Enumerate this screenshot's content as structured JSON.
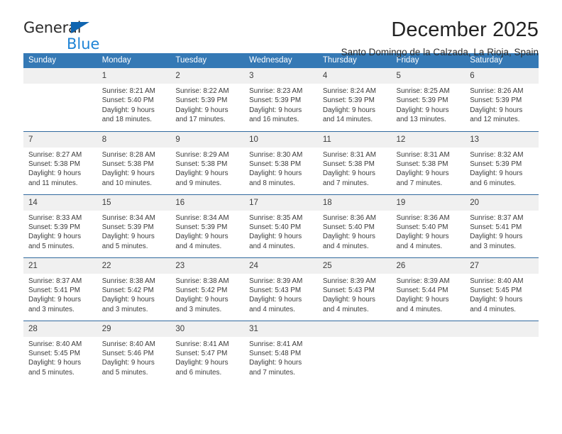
{
  "logo": {
    "line1": "General",
    "line2": "Blue",
    "triangle_icon": "triangle-icon",
    "color_dark": "#2b2b2b",
    "color_blue": "#1f84d6",
    "triangle_color": "#1065b0"
  },
  "header": {
    "title": "December 2025",
    "subtitle": "Santo Domingo de la Calzada, La Rioja, Spain"
  },
  "theme": {
    "header_blue": "#3579b5",
    "row_rule": "#31699e",
    "daynum_band": "#f0f0f0",
    "text": "#3b3b3b"
  },
  "weekday_headers": [
    "Sunday",
    "Monday",
    "Tuesday",
    "Wednesday",
    "Thursday",
    "Friday",
    "Saturday"
  ],
  "weeks": [
    [
      {
        "day": "",
        "empty": true,
        "sunrise": "",
        "sunset": "",
        "daylight_line1": "",
        "daylight_line2": ""
      },
      {
        "day": "1",
        "empty": false,
        "sunrise": "Sunrise: 8:21 AM",
        "sunset": "Sunset: 5:40 PM",
        "daylight_line1": "Daylight: 9 hours",
        "daylight_line2": "and 18 minutes."
      },
      {
        "day": "2",
        "empty": false,
        "sunrise": "Sunrise: 8:22 AM",
        "sunset": "Sunset: 5:39 PM",
        "daylight_line1": "Daylight: 9 hours",
        "daylight_line2": "and 17 minutes."
      },
      {
        "day": "3",
        "empty": false,
        "sunrise": "Sunrise: 8:23 AM",
        "sunset": "Sunset: 5:39 PM",
        "daylight_line1": "Daylight: 9 hours",
        "daylight_line2": "and 16 minutes."
      },
      {
        "day": "4",
        "empty": false,
        "sunrise": "Sunrise: 8:24 AM",
        "sunset": "Sunset: 5:39 PM",
        "daylight_line1": "Daylight: 9 hours",
        "daylight_line2": "and 14 minutes."
      },
      {
        "day": "5",
        "empty": false,
        "sunrise": "Sunrise: 8:25 AM",
        "sunset": "Sunset: 5:39 PM",
        "daylight_line1": "Daylight: 9 hours",
        "daylight_line2": "and 13 minutes."
      },
      {
        "day": "6",
        "empty": false,
        "sunrise": "Sunrise: 8:26 AM",
        "sunset": "Sunset: 5:39 PM",
        "daylight_line1": "Daylight: 9 hours",
        "daylight_line2": "and 12 minutes."
      }
    ],
    [
      {
        "day": "7",
        "empty": false,
        "sunrise": "Sunrise: 8:27 AM",
        "sunset": "Sunset: 5:38 PM",
        "daylight_line1": "Daylight: 9 hours",
        "daylight_line2": "and 11 minutes."
      },
      {
        "day": "8",
        "empty": false,
        "sunrise": "Sunrise: 8:28 AM",
        "sunset": "Sunset: 5:38 PM",
        "daylight_line1": "Daylight: 9 hours",
        "daylight_line2": "and 10 minutes."
      },
      {
        "day": "9",
        "empty": false,
        "sunrise": "Sunrise: 8:29 AM",
        "sunset": "Sunset: 5:38 PM",
        "daylight_line1": "Daylight: 9 hours",
        "daylight_line2": "and 9 minutes."
      },
      {
        "day": "10",
        "empty": false,
        "sunrise": "Sunrise: 8:30 AM",
        "sunset": "Sunset: 5:38 PM",
        "daylight_line1": "Daylight: 9 hours",
        "daylight_line2": "and 8 minutes."
      },
      {
        "day": "11",
        "empty": false,
        "sunrise": "Sunrise: 8:31 AM",
        "sunset": "Sunset: 5:38 PM",
        "daylight_line1": "Daylight: 9 hours",
        "daylight_line2": "and 7 minutes."
      },
      {
        "day": "12",
        "empty": false,
        "sunrise": "Sunrise: 8:31 AM",
        "sunset": "Sunset: 5:38 PM",
        "daylight_line1": "Daylight: 9 hours",
        "daylight_line2": "and 7 minutes."
      },
      {
        "day": "13",
        "empty": false,
        "sunrise": "Sunrise: 8:32 AM",
        "sunset": "Sunset: 5:39 PM",
        "daylight_line1": "Daylight: 9 hours",
        "daylight_line2": "and 6 minutes."
      }
    ],
    [
      {
        "day": "14",
        "empty": false,
        "sunrise": "Sunrise: 8:33 AM",
        "sunset": "Sunset: 5:39 PM",
        "daylight_line1": "Daylight: 9 hours",
        "daylight_line2": "and 5 minutes."
      },
      {
        "day": "15",
        "empty": false,
        "sunrise": "Sunrise: 8:34 AM",
        "sunset": "Sunset: 5:39 PM",
        "daylight_line1": "Daylight: 9 hours",
        "daylight_line2": "and 5 minutes."
      },
      {
        "day": "16",
        "empty": false,
        "sunrise": "Sunrise: 8:34 AM",
        "sunset": "Sunset: 5:39 PM",
        "daylight_line1": "Daylight: 9 hours",
        "daylight_line2": "and 4 minutes."
      },
      {
        "day": "17",
        "empty": false,
        "sunrise": "Sunrise: 8:35 AM",
        "sunset": "Sunset: 5:40 PM",
        "daylight_line1": "Daylight: 9 hours",
        "daylight_line2": "and 4 minutes."
      },
      {
        "day": "18",
        "empty": false,
        "sunrise": "Sunrise: 8:36 AM",
        "sunset": "Sunset: 5:40 PM",
        "daylight_line1": "Daylight: 9 hours",
        "daylight_line2": "and 4 minutes."
      },
      {
        "day": "19",
        "empty": false,
        "sunrise": "Sunrise: 8:36 AM",
        "sunset": "Sunset: 5:40 PM",
        "daylight_line1": "Daylight: 9 hours",
        "daylight_line2": "and 4 minutes."
      },
      {
        "day": "20",
        "empty": false,
        "sunrise": "Sunrise: 8:37 AM",
        "sunset": "Sunset: 5:41 PM",
        "daylight_line1": "Daylight: 9 hours",
        "daylight_line2": "and 3 minutes."
      }
    ],
    [
      {
        "day": "21",
        "empty": false,
        "sunrise": "Sunrise: 8:37 AM",
        "sunset": "Sunset: 5:41 PM",
        "daylight_line1": "Daylight: 9 hours",
        "daylight_line2": "and 3 minutes."
      },
      {
        "day": "22",
        "empty": false,
        "sunrise": "Sunrise: 8:38 AM",
        "sunset": "Sunset: 5:42 PM",
        "daylight_line1": "Daylight: 9 hours",
        "daylight_line2": "and 3 minutes."
      },
      {
        "day": "23",
        "empty": false,
        "sunrise": "Sunrise: 8:38 AM",
        "sunset": "Sunset: 5:42 PM",
        "daylight_line1": "Daylight: 9 hours",
        "daylight_line2": "and 3 minutes."
      },
      {
        "day": "24",
        "empty": false,
        "sunrise": "Sunrise: 8:39 AM",
        "sunset": "Sunset: 5:43 PM",
        "daylight_line1": "Daylight: 9 hours",
        "daylight_line2": "and 4 minutes."
      },
      {
        "day": "25",
        "empty": false,
        "sunrise": "Sunrise: 8:39 AM",
        "sunset": "Sunset: 5:43 PM",
        "daylight_line1": "Daylight: 9 hours",
        "daylight_line2": "and 4 minutes."
      },
      {
        "day": "26",
        "empty": false,
        "sunrise": "Sunrise: 8:39 AM",
        "sunset": "Sunset: 5:44 PM",
        "daylight_line1": "Daylight: 9 hours",
        "daylight_line2": "and 4 minutes."
      },
      {
        "day": "27",
        "empty": false,
        "sunrise": "Sunrise: 8:40 AM",
        "sunset": "Sunset: 5:45 PM",
        "daylight_line1": "Daylight: 9 hours",
        "daylight_line2": "and 4 minutes."
      }
    ],
    [
      {
        "day": "28",
        "empty": false,
        "sunrise": "Sunrise: 8:40 AM",
        "sunset": "Sunset: 5:45 PM",
        "daylight_line1": "Daylight: 9 hours",
        "daylight_line2": "and 5 minutes."
      },
      {
        "day": "29",
        "empty": false,
        "sunrise": "Sunrise: 8:40 AM",
        "sunset": "Sunset: 5:46 PM",
        "daylight_line1": "Daylight: 9 hours",
        "daylight_line2": "and 5 minutes."
      },
      {
        "day": "30",
        "empty": false,
        "sunrise": "Sunrise: 8:41 AM",
        "sunset": "Sunset: 5:47 PM",
        "daylight_line1": "Daylight: 9 hours",
        "daylight_line2": "and 6 minutes."
      },
      {
        "day": "31",
        "empty": false,
        "sunrise": "Sunrise: 8:41 AM",
        "sunset": "Sunset: 5:48 PM",
        "daylight_line1": "Daylight: 9 hours",
        "daylight_line2": "and 7 minutes."
      },
      {
        "day": "",
        "empty": true,
        "sunrise": "",
        "sunset": "",
        "daylight_line1": "",
        "daylight_line2": ""
      },
      {
        "day": "",
        "empty": true,
        "sunrise": "",
        "sunset": "",
        "daylight_line1": "",
        "daylight_line2": ""
      },
      {
        "day": "",
        "empty": true,
        "sunrise": "",
        "sunset": "",
        "daylight_line1": "",
        "daylight_line2": ""
      }
    ]
  ]
}
